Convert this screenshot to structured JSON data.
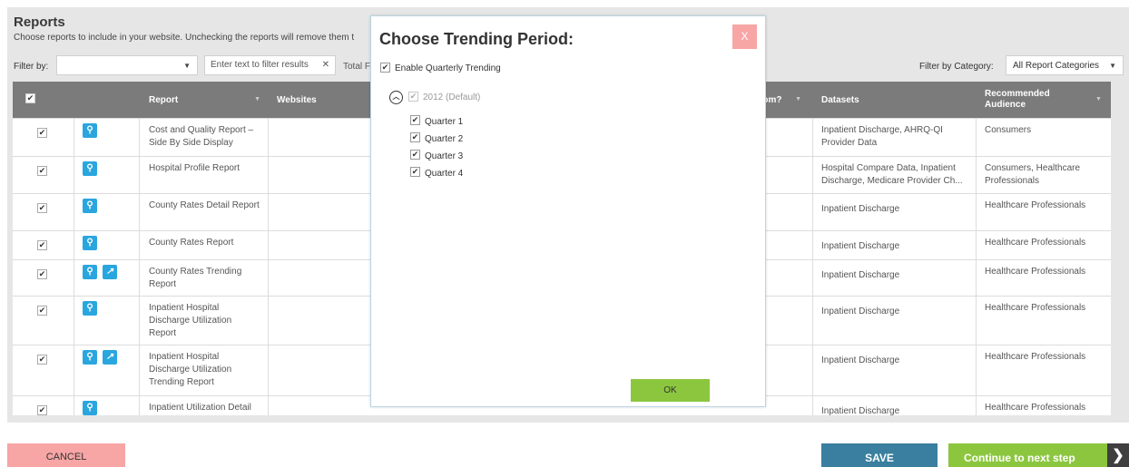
{
  "page": {
    "title": "Reports",
    "subtitle": "Choose reports to include in your website.  Unchecking the reports will remove them t"
  },
  "filters": {
    "filter_by_label": "Filter by:",
    "filter_by_value": "",
    "text_placeholder": "Enter text to filter results",
    "total_label": "Total F",
    "category_label": "Filter by Category:",
    "category_value": "All Report Categories"
  },
  "grid": {
    "columns": {
      "report": "Report",
      "websites": "Websites",
      "custom": "tom?",
      "datasets": "Datasets",
      "audience": "Recommended Audience"
    },
    "rows": [
      {
        "report": "Cost and Quality Report – Side By Side Display",
        "datasets": "Inpatient Discharge, AHRQ-QI Provider Data",
        "audience": "Consumers",
        "trending": false
      },
      {
        "report": "Hospital Profile Report",
        "datasets": "Hospital Compare Data, Inpatient Discharge, Medicare Provider Ch...",
        "audience": "Consumers, Healthcare Professionals",
        "trending": false
      },
      {
        "report": "County Rates Detail Report",
        "datasets": "Inpatient Discharge",
        "audience": "Healthcare Professionals",
        "trending": false
      },
      {
        "report": "County Rates Report",
        "datasets": "Inpatient Discharge",
        "audience": "Healthcare Professionals",
        "trending": false
      },
      {
        "report": "County Rates Trending Report",
        "datasets": "Inpatient Discharge",
        "audience": "Healthcare Professionals",
        "trending": true
      },
      {
        "report": "Inpatient Hospital Discharge Utilization Report",
        "datasets": "Inpatient Discharge",
        "audience": "Healthcare Professionals",
        "trending": false
      },
      {
        "report": "Inpatient Hospital Discharge Utilization Trending Report",
        "datasets": "Inpatient Discharge",
        "audience": "Healthcare Professionals",
        "trending": true
      },
      {
        "report": "Inpatient Utilization Detail",
        "datasets": "Inpatient Discharge",
        "audience": "Healthcare Professionals",
        "trending": false
      }
    ]
  },
  "buttons": {
    "cancel": "CANCEL",
    "save": "SAVE",
    "continue": "Continue to next step"
  },
  "modal": {
    "title": "Choose Trending Period:",
    "close": "X",
    "enable_label": "Enable Quarterly Trending",
    "year_label": "2012 (Default)",
    "quarters": [
      "Quarter 1",
      "Quarter 2",
      "Quarter 3",
      "Quarter 4"
    ],
    "ok": "OK"
  },
  "icons": {
    "preview": "magnifier-icon",
    "trending": "trend-line-icon",
    "collapse": "chevron-up-circle-icon"
  },
  "colors": {
    "header_bg": "#7b7b7b",
    "preview_icon": "#2aa6df",
    "cancel": "#f7a5a5",
    "save": "#3a7f9f",
    "continue": "#8cc63f"
  }
}
